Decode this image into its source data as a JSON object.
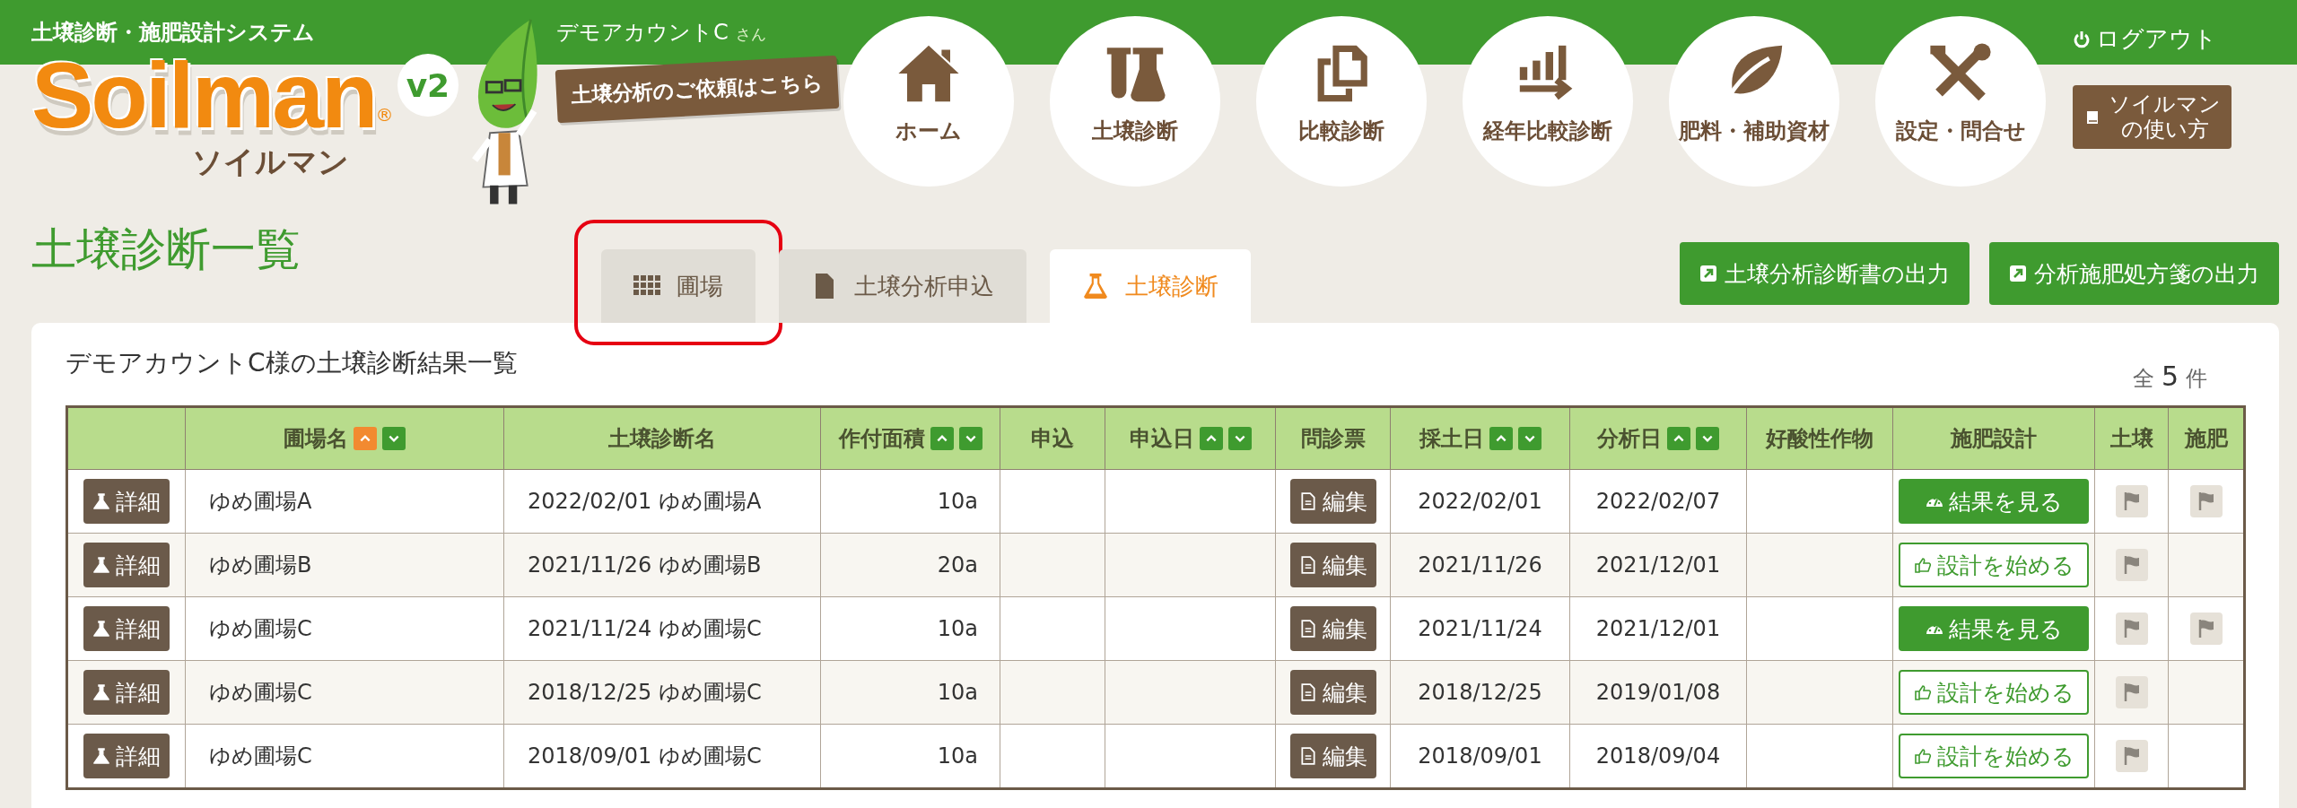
{
  "header": {
    "system_title": "土壌診断・施肥設計システム",
    "logo_text": "Soilman",
    "logo_mark": "®",
    "logo_kana": "ソイルマン",
    "version_badge": "v2",
    "account_name": "デモアカウントC",
    "account_suffix": "さん",
    "request_sign": "土壌分析のご依頼はこちら",
    "nav": [
      {
        "label": "ホーム"
      },
      {
        "label": "土壌診断"
      },
      {
        "label": "比較診断"
      },
      {
        "label": "経年比較診断"
      },
      {
        "label": "肥料・補助資材"
      },
      {
        "label": "設定・問合せ"
      }
    ],
    "logout": "ログアウト",
    "help_button": [
      "ソイルマン",
      "の使い方"
    ]
  },
  "page_title": "土壌診断一覧",
  "tabs": [
    {
      "label": "圃場",
      "selected": false,
      "highlighted": true
    },
    {
      "label": "土壌分析申込",
      "selected": false,
      "highlighted": false
    },
    {
      "label": "土壌診断",
      "selected": true,
      "highlighted": false
    }
  ],
  "export_buttons": [
    "土壌分析診断書の出力",
    "分析施肥処方箋の出力"
  ],
  "panel": {
    "title": "デモアカウントC様の土壌診断結果一覧",
    "count_prefix": "全",
    "count": "5",
    "count_suffix": "件"
  },
  "table": {
    "columns": [
      {
        "label": "圃場名",
        "sorted": true
      },
      {
        "label": "土壌診断名"
      },
      {
        "label": "作付面積",
        "sorted": false
      },
      {
        "label": "申込"
      },
      {
        "label": "申込日",
        "sorted": false
      },
      {
        "label": "問診票"
      },
      {
        "label": "採土日",
        "sorted": false
      },
      {
        "label": "分析日",
        "sorted": false
      },
      {
        "label": "好酸性作物"
      },
      {
        "label": "施肥設計"
      },
      {
        "label": "土壌"
      },
      {
        "label": "施肥"
      }
    ],
    "rows": [
      {
        "detail": "詳細",
        "field": "ゆめ圃場A",
        "name": "2022/02/01 ゆめ圃場A",
        "area": "10a",
        "interview": "編集",
        "sampled": "2022/02/01",
        "analyzed": "2022/02/07",
        "design": {
          "kind": "result",
          "label": "結果を見る"
        },
        "soil_flag": true,
        "fert_flag": true
      },
      {
        "detail": "詳細",
        "field": "ゆめ圃場B",
        "name": "2021/11/26 ゆめ圃場B",
        "area": "20a",
        "interview": "編集",
        "sampled": "2021/11/26",
        "analyzed": "2021/12/01",
        "design": {
          "kind": "start",
          "label": "設計を始める"
        },
        "soil_flag": true,
        "fert_flag": false
      },
      {
        "detail": "詳細",
        "field": "ゆめ圃場C",
        "name": "2021/11/24 ゆめ圃場C",
        "area": "10a",
        "interview": "編集",
        "sampled": "2021/11/24",
        "analyzed": "2021/12/01",
        "design": {
          "kind": "result",
          "label": "結果を見る"
        },
        "soil_flag": true,
        "fert_flag": true
      },
      {
        "detail": "詳細",
        "field": "ゆめ圃場C",
        "name": "2018/12/25 ゆめ圃場C",
        "area": "10a",
        "interview": "編集",
        "sampled": "2018/12/25",
        "analyzed": "2019/01/08",
        "design": {
          "kind": "start",
          "label": "設計を始める"
        },
        "soil_flag": true,
        "fert_flag": false
      },
      {
        "detail": "詳細",
        "field": "ゆめ圃場C",
        "name": "2018/09/01 ゆめ圃場C",
        "area": "10a",
        "interview": "編集",
        "sampled": "2018/09/01",
        "analyzed": "2018/09/04",
        "design": {
          "kind": "start",
          "label": "設計を始める"
        },
        "soil_flag": true,
        "fert_flag": false
      }
    ]
  }
}
